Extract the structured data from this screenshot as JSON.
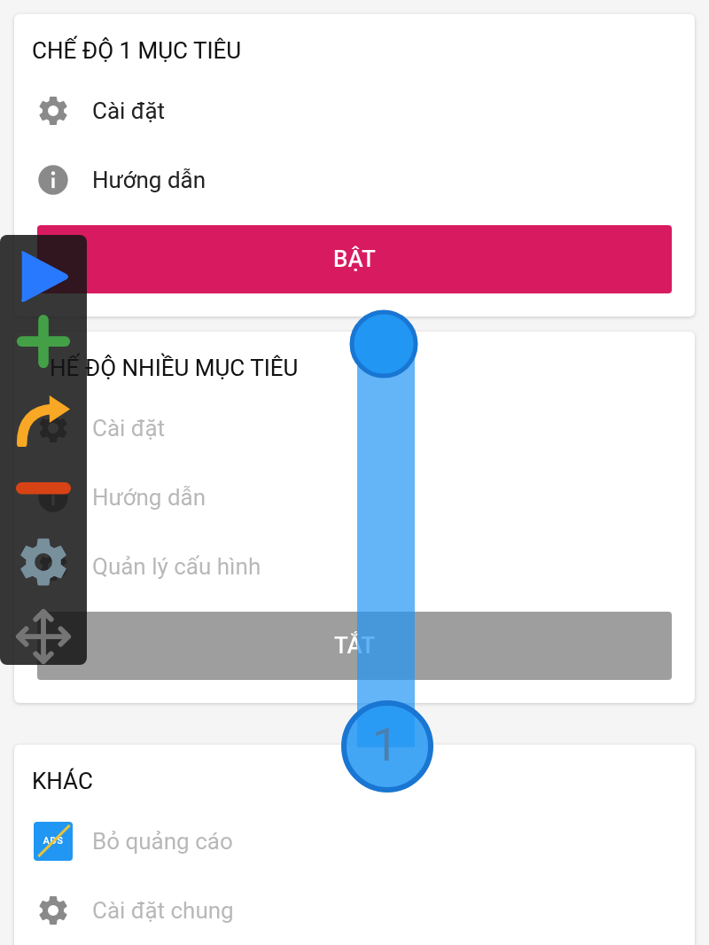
{
  "sections": [
    {
      "title": "CHẾ ĐỘ 1 MỤC TIÊU",
      "items": [
        {
          "kind": "gear",
          "label": "Cài đặt",
          "disabled": false
        },
        {
          "kind": "info",
          "label": "Hướng dẫn",
          "disabled": false
        }
      ],
      "button": {
        "label": "BẬT",
        "on": true
      }
    },
    {
      "title": "HẾ ĐỘ NHIỀU MỤC TIÊU",
      "title_covered": true,
      "items": [
        {
          "kind": "gear",
          "label": "Cài đặt",
          "disabled": true
        },
        {
          "kind": "info",
          "label": "Hướng dẫn",
          "disabled": true
        },
        {
          "kind": "gear",
          "label": "Quản lý cấu hình",
          "disabled": true
        }
      ],
      "button": {
        "label": "TẮT",
        "on": false
      }
    },
    {
      "title": "KHÁC",
      "items": [
        {
          "kind": "ads",
          "label": "Bỏ quảng cáo",
          "icon_text": "ADS",
          "disabled": true
        },
        {
          "kind": "gear",
          "label": "Cài đặt chung",
          "disabled": true
        }
      ]
    }
  ],
  "swipe_marker": {
    "label": "1"
  }
}
